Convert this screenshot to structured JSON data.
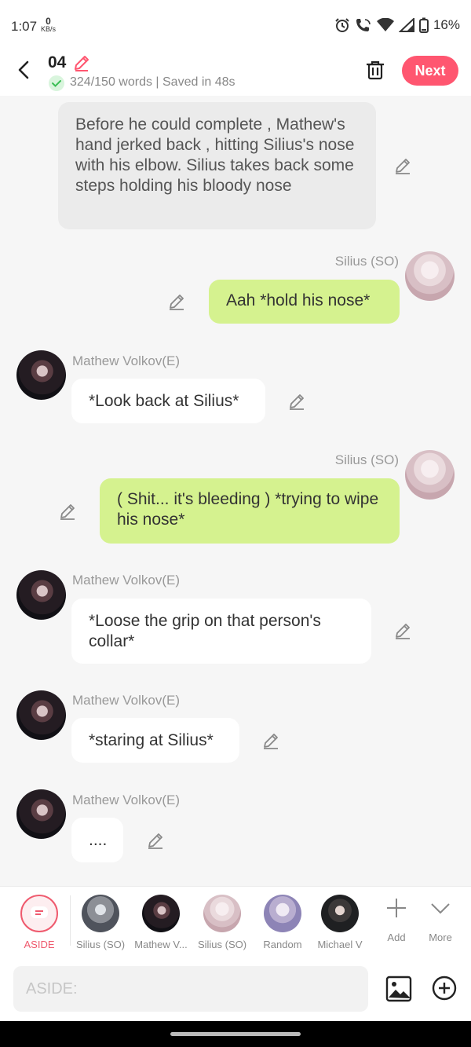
{
  "status_bar": {
    "time": "1:07",
    "speed_value": "0",
    "speed_unit": "KB/s",
    "battery": "16%"
  },
  "header": {
    "title": "04",
    "meta": "324/150 words | Saved in 48s",
    "next_label": "Next"
  },
  "messages": {
    "narration": "Before he could complete , Mathew's hand jerked back , hitting Silius's nose with his elbow. Silius takes back some steps holding his bloody nose",
    "m1_speaker": "Silius (SO)",
    "m1_text": "Aah  *hold his nose*",
    "m2_speaker": "Mathew Volkov(E)",
    "m2_text": "*Look back at Silius*",
    "m3_speaker": "Silius (SO)",
    "m3_text": "( Shit... it's bleeding ) *trying to wipe his nose*",
    "m4_speaker": "Mathew Volkov(E)",
    "m4_text": "*Loose the grip on that person's collar*",
    "m5_speaker": "Mathew Volkov(E)",
    "m5_text": "*staring at Silius*",
    "m6_speaker": "Mathew Volkov(E)",
    "m6_text": "...."
  },
  "characters": {
    "aside": "ASIDE",
    "c1": "Silius (SO)",
    "c2": "Mathew V...",
    "c3": "Silius (SO)",
    "c4": "Random",
    "c5": "Michael V",
    "add": "Add",
    "more": "More"
  },
  "input": {
    "placeholder": "ASIDE:"
  },
  "colors": {
    "accent": "#ff5670",
    "right_bubble": "#d5f28f",
    "aside_red": "#ef5a6e"
  }
}
